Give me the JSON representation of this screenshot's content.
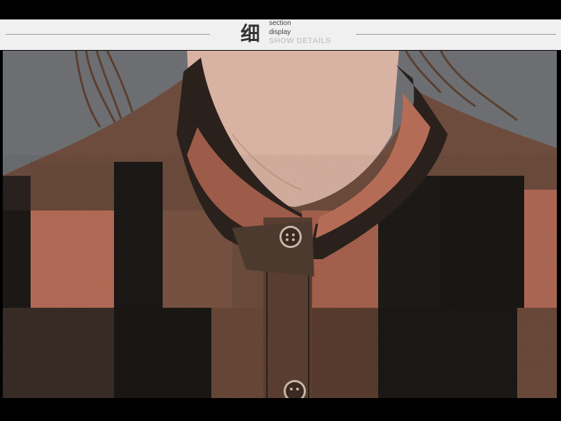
{
  "header": {
    "glyph": "细",
    "line1": "section",
    "line2": "display",
    "line3": "SHOW DETAILS"
  },
  "photo": {
    "subject": "plaid-shirt-collar-closeup",
    "colors": {
      "background": "#6d6f73",
      "black_check": "#1b1816",
      "rust_check": "#b56c57",
      "mid_check": "#6e4c3d",
      "skin": "#d9b3a3",
      "button": "#3a2a22"
    }
  }
}
